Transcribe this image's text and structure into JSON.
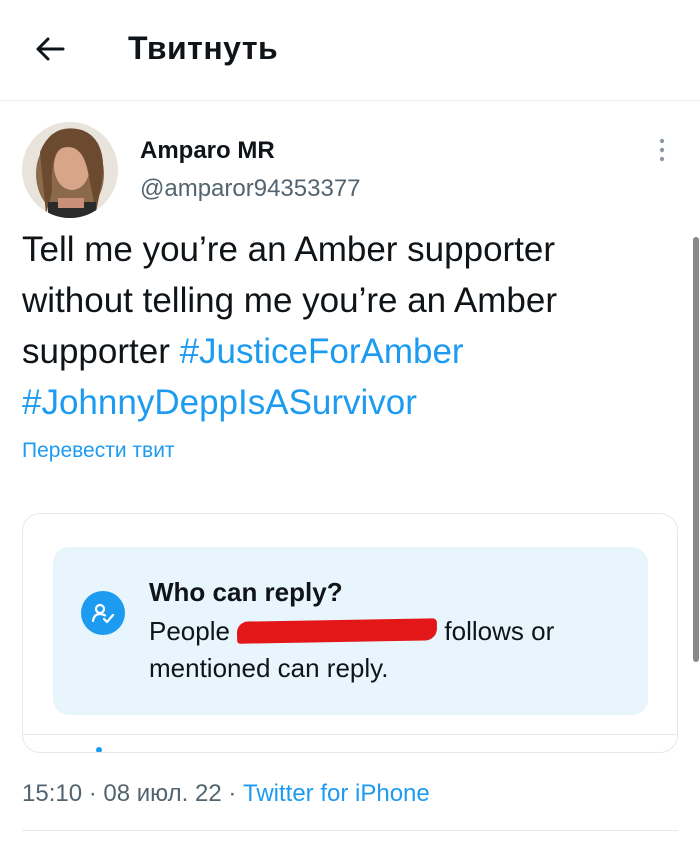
{
  "header": {
    "back_icon": "arrow-left-icon",
    "title": "Твитнуть"
  },
  "tweet": {
    "author": {
      "display_name": "Amparo MR",
      "username": "@amparor94353377",
      "avatar_icon": "user-avatar"
    },
    "text_line1": "Tell me you’re an Amber supporter",
    "text_line2": "without telling me you’re an Amber",
    "text_line3": "supporter ",
    "hashtag1": "#JusticeForAmber",
    "hashtag2": "#JohnnyDeppIsASurvivor",
    "translate_label": "Перевести твит",
    "more_icon": "more-vertical-icon"
  },
  "reply_card": {
    "icon": "reply-restriction-icon",
    "title": "Who can reply?",
    "body_prefix": "People ",
    "body_suffix": " follows or",
    "body_line2": "mentioned can reply."
  },
  "meta": {
    "time": "15:10",
    "sep1": " · ",
    "date": "08 июл. 22",
    "sep2": " · ",
    "source": "Twitter for iPhone"
  },
  "colors": {
    "accent": "#1d9bf0",
    "text": "#0f1419",
    "muted": "#536471",
    "card_bg": "#e8f5fd",
    "redaction": "#e31717"
  }
}
